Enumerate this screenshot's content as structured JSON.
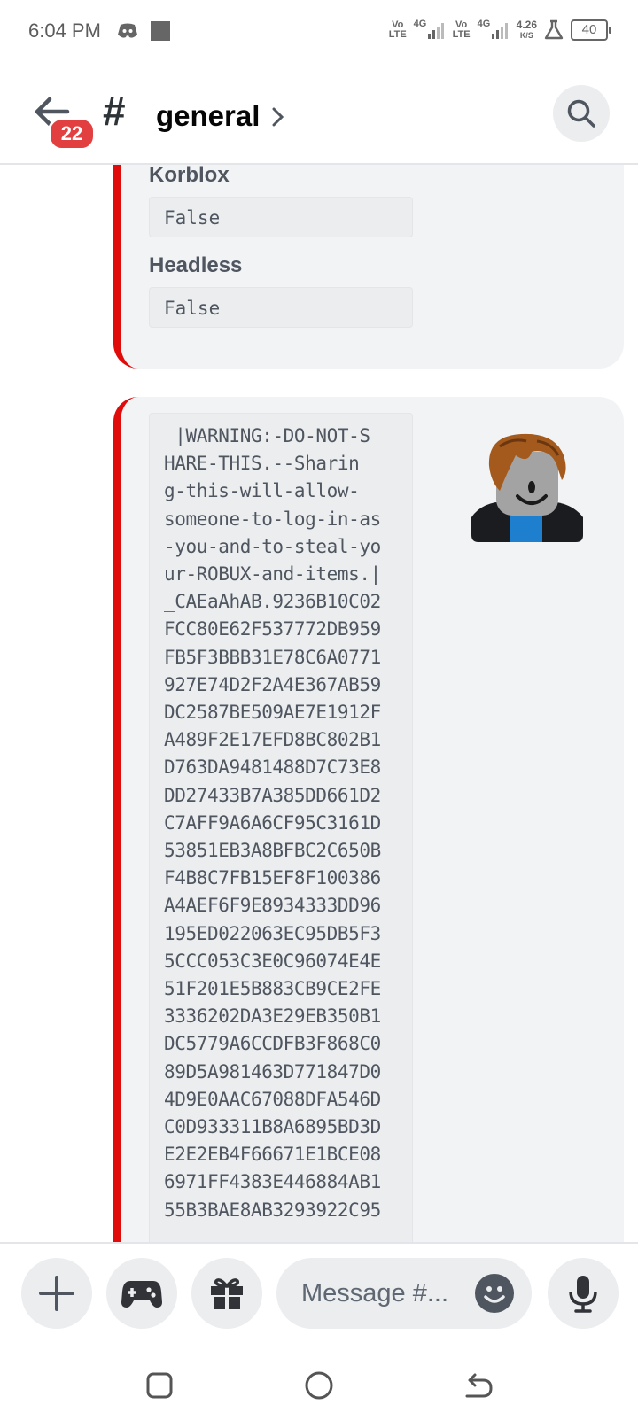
{
  "status_bar": {
    "time": "6:04 PM",
    "volte1": "Vo\nLTE",
    "net1": "4G",
    "volte2": "Vo\nLTE",
    "net2": "4G",
    "speed_value": "4.26",
    "speed_unit": "K/S",
    "battery": "40"
  },
  "header": {
    "badge_count": "22",
    "hash": "#",
    "channel_name": "general"
  },
  "embed_fields": [
    {
      "name": "Korblox",
      "value": "False"
    },
    {
      "name": "Headless",
      "value": "False"
    }
  ],
  "code_lines": [
    "_|WARNING:-DO-NOT-S",
    "HARE-THIS.--Sharin",
    "g-this-will-allow-",
    "someone-to-log-in-as",
    "-you-and-to-steal-yo",
    "ur-ROBUX-and-items.|",
    "_CAEaAhAB.9236B10C02",
    "FCC80E62F537772DB959",
    "FB5F3BBB31E78C6A0771",
    "927E74D2F2A4E367AB59",
    "DC2587BE509AE7E1912F",
    "A489F2E17EFD8BC802B1",
    "D763DA9481488D7C73E8",
    "DD27433B7A385DD661D2",
    "C7AFF9A6A6CF95C3161D",
    "53851EB3A8BFBC2C650B",
    "F4B8C7FB15EF8F100386",
    "A4AEF6F9E8934333DD96",
    "195ED022063EC95DB5F3",
    "5CCC053C3E0C96074E4E",
    "51F201E5B883CB9CE2FE",
    "3336202DA3E29EB350B1",
    "DC5779A6CCDFB3F868C0",
    "89D5A981463D771847D0",
    "4D9E0AAC67088DFA546D",
    "C0D933311B8A6895BD3D",
    "E2E2EB4F66671E1BCE08",
    "6971FF4383E446884AB1",
    "55B3BAE8AB3293922C95"
  ],
  "input": {
    "placeholder": "Message #..."
  },
  "colors": {
    "accent": "#e00b0b",
    "badge": "#e23f40",
    "embed_bg": "#f2f3f5"
  },
  "icons": {
    "back": "arrow-left-icon",
    "search": "search-icon",
    "add": "plus-icon",
    "games": "gamepad-icon",
    "gift": "gift-icon",
    "emoji": "emoji-icon",
    "mic": "microphone-icon",
    "recents": "square-icon",
    "home": "circle-icon",
    "back_nav": "return-icon"
  }
}
